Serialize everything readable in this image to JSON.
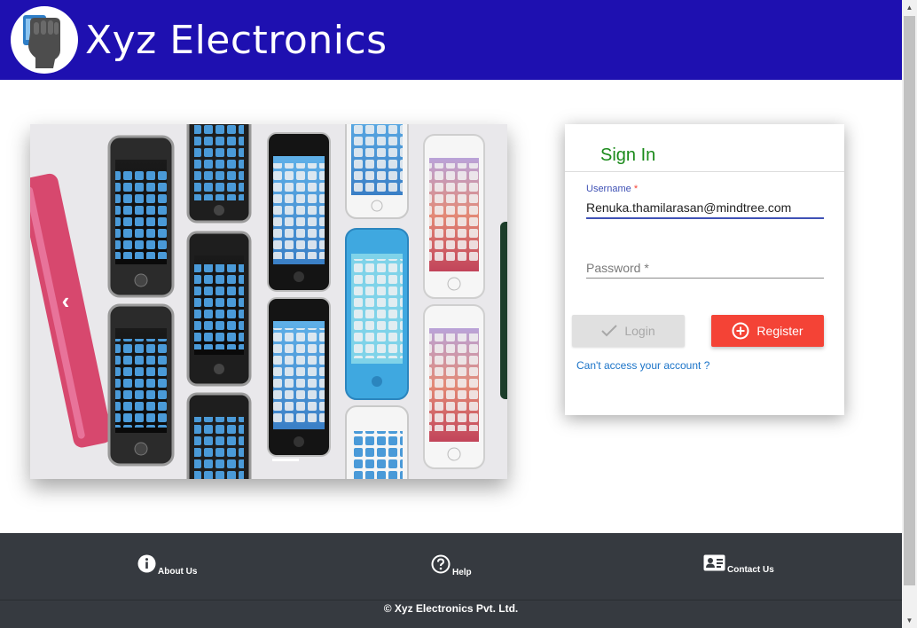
{
  "header": {
    "title": "Xyz Electronics",
    "logo_icon": "hand-holding-phone-icon",
    "bg_color": "#1e10b0"
  },
  "carousel": {
    "prev_icon": "chevron-left-icon",
    "slide_count": 2,
    "active_index": 0
  },
  "signin": {
    "title": "Sign In",
    "username_label": "Username",
    "username_required_mark": "*",
    "username_value": "Renuka.thamilarasan@mindtree.com",
    "password_placeholder": "Password *",
    "login_label": "Login",
    "register_label": "Register",
    "cant_access_link": "Can't access your account ?",
    "accent_color": "#3f51b5",
    "register_color": "#f44336",
    "title_color": "#1a8a1a"
  },
  "footer": {
    "about_label": "About Us",
    "help_label": "Help",
    "contact_label": "Contact Us",
    "copyright": "© Xyz Electronics Pvt. Ltd.",
    "bg_color": "#363a40"
  }
}
